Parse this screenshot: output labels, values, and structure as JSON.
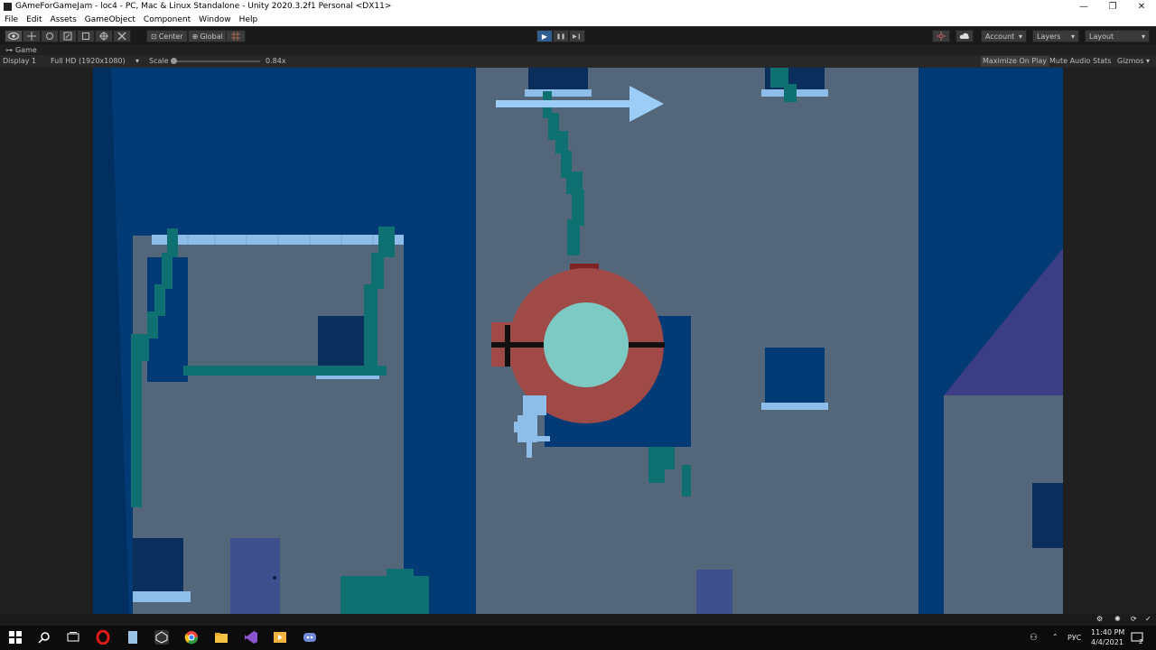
{
  "window": {
    "title": "GAmeForGameJam - loc4 - PC, Mac & Linux Standalone - Unity 2020.3.2f1 Personal <DX11>",
    "minimize": "—",
    "maximize": "❐",
    "close": "✕"
  },
  "menu": [
    "File",
    "Edit",
    "Assets",
    "GameObject",
    "Component",
    "Window",
    "Help"
  ],
  "toolbar": {
    "pivot_label": "Center",
    "space_label": "Global",
    "account_label": "Account",
    "layers_label": "Layers",
    "layout_label": "Layout",
    "dropdown_arrow": "▾",
    "play_icon": "▶",
    "pause_icon": "❚❚",
    "step_icon": "▶❙"
  },
  "game_tab": {
    "label": "Game",
    "display": "Display 1",
    "resolution": "Full HD (1920x1080)",
    "scale_label": "Scale",
    "scale_value": "0.84x",
    "maximize_on_play": "Maximize On Play",
    "mute_audio": "Mute Audio",
    "stats": "Stats",
    "gizmos": "Gizmos"
  },
  "tray": {
    "language": "РУС",
    "time": "11:40 PM",
    "date": "4/4/2021",
    "notifications": "2"
  },
  "colors": {
    "game_bg": "#54677a",
    "dark_blue": "#023a75",
    "navy": "#0b2f5c",
    "ledge": "#8ebde9",
    "vine": "#0e7070",
    "ring": "#a04a48",
    "core": "#7ccac3",
    "arrow": "#9ccdf6",
    "roof": "#3b3e84"
  }
}
